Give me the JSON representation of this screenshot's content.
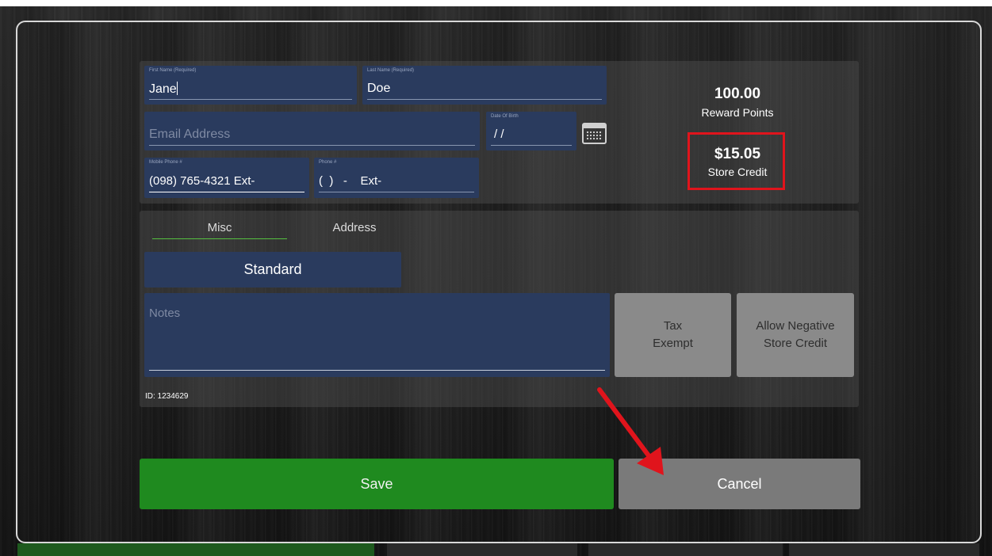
{
  "customer_form": {
    "first_name": {
      "label": "First Name (Required)",
      "value": "Jane"
    },
    "last_name": {
      "label": "Last Name (Required)",
      "value": "Doe"
    },
    "email": {
      "placeholder": "Email Address",
      "value": ""
    },
    "dob": {
      "label": "Date Of Birth",
      "value": "/ /"
    },
    "mobile_phone": {
      "label": "Mobile Phone #",
      "value": "(098) 765-4321 Ext-"
    },
    "phone": {
      "label": "Phone #",
      "value": "(  )   -    Ext-"
    }
  },
  "stats": {
    "reward_points_value": "100.00",
    "reward_points_label": "Reward Points",
    "store_credit_value": "$15.05",
    "store_credit_label": "Store Credit"
  },
  "tabs": [
    {
      "label": "Misc",
      "active": true
    },
    {
      "label": "Address",
      "active": false
    }
  ],
  "misc": {
    "price_level": "Standard",
    "notes_placeholder": "Notes",
    "tax_exempt_label": "Tax\nExempt",
    "allow_negative_label": "Allow Negative\nStore Credit",
    "customer_id": "ID: 1234629"
  },
  "actions": {
    "save_label": "Save",
    "cancel_label": "Cancel"
  },
  "annotation": {
    "highlight_color": "#e0141c",
    "arrow_color": "#e0141c"
  },
  "icons": {
    "calendar": "calendar-icon"
  }
}
